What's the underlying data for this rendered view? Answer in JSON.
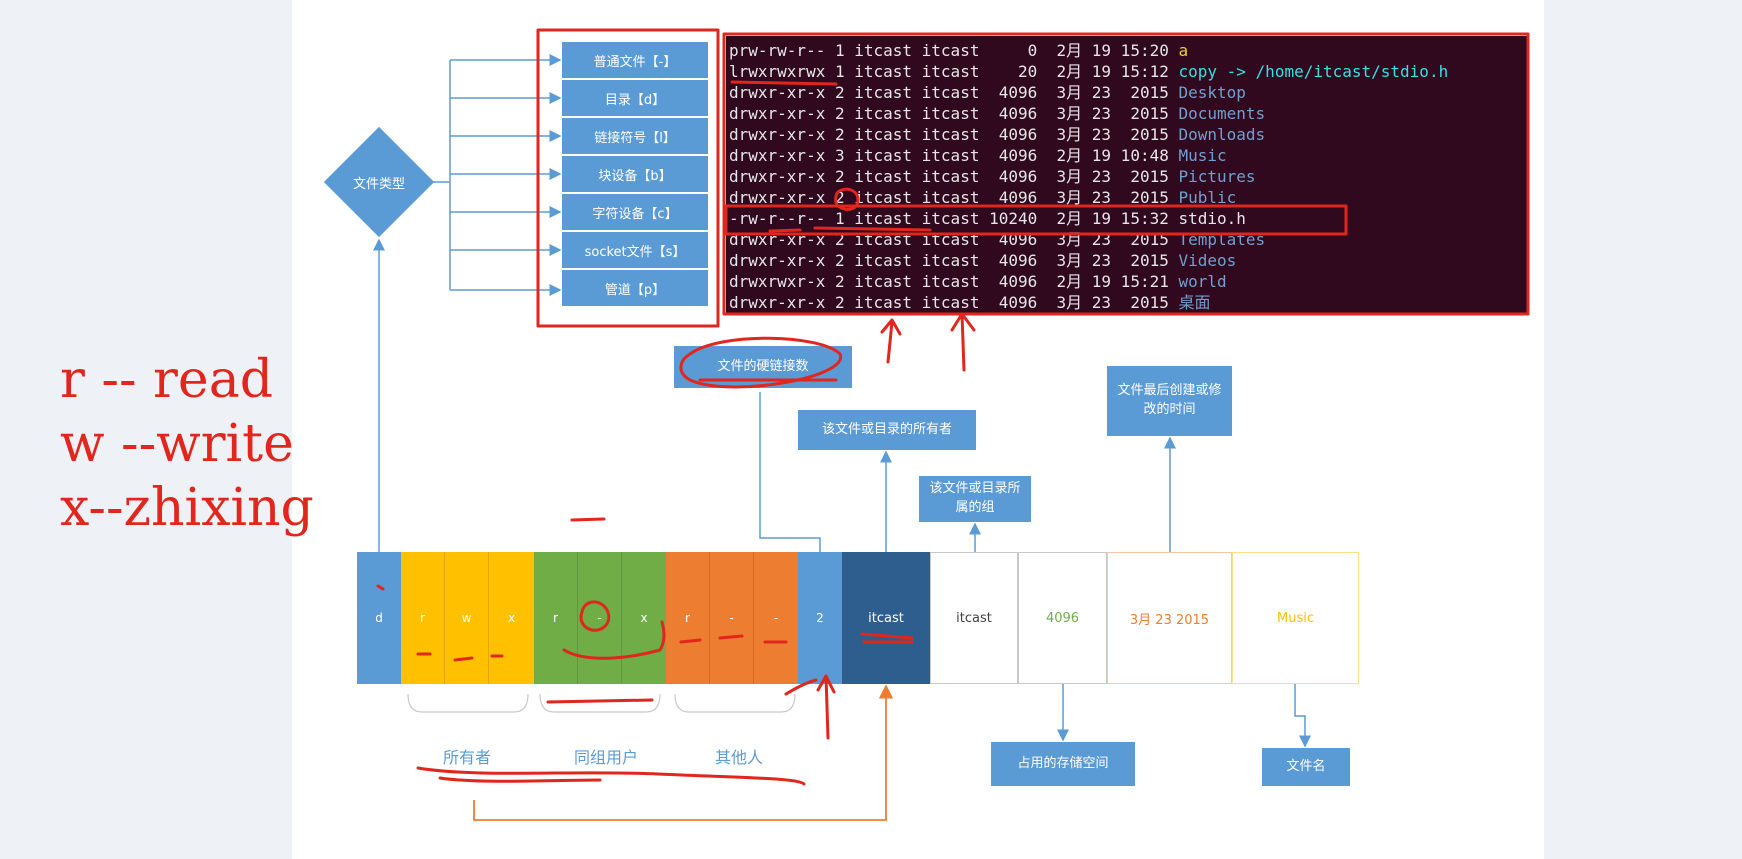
{
  "file_types": {
    "title": "文件类型",
    "items": [
      "普通文件【-】",
      "目录【d】",
      "链接符号【l】",
      "块设备【b】",
      "字符设备【c】",
      "socket文件【s】",
      "管道【p】"
    ]
  },
  "terminal": {
    "lines": [
      {
        "text": "prw-rw-r-- 1 itcast itcast     0  2月 19 15:20 ",
        "name": "a",
        "color": "yellow"
      },
      {
        "text": "lrwxrwxrwx 1 itcast itcast    20  2月 19 15:12 ",
        "name": "copy -> /home/itcast/stdio.h",
        "color": "cyan"
      },
      {
        "text": "drwxr-xr-x 2 itcast itcast  4096  3月 23  2015 ",
        "name": "Desktop",
        "color": "blue"
      },
      {
        "text": "drwxr-xr-x 2 itcast itcast  4096  3月 23  2015 ",
        "name": "Documents",
        "color": "blue"
      },
      {
        "text": "drwxr-xr-x 2 itcast itcast  4096  3月 23  2015 ",
        "name": "Downloads",
        "color": "blue"
      },
      {
        "text": "drwxr-xr-x 3 itcast itcast  4096  2月 19 10:48 ",
        "name": "Music",
        "color": "blue"
      },
      {
        "text": "drwxr-xr-x 2 itcast itcast  4096  3月 23  2015 ",
        "name": "Pictures",
        "color": "blue"
      },
      {
        "text": "drwxr-xr-x 2 itcast itcast  4096  3月 23  2015 ",
        "name": "Public",
        "color": "blue"
      },
      {
        "text": "-rw-r--r-- 1 itcast itcast 10240  2月 19 15:32 ",
        "name": "stdio.h",
        "color": "white"
      },
      {
        "text": "drwxr-xr-x 2 itcast itcast  4096  3月 23  2015 ",
        "name": "Templates",
        "color": "blue"
      },
      {
        "text": "drwxr-xr-x 2 itcast itcast  4096  3月 23  2015 ",
        "name": "Videos",
        "color": "blue"
      },
      {
        "text": "drwxrwxr-x 2 itcast itcast  4096  2月 19 15:21 ",
        "name": "world",
        "color": "blue"
      },
      {
        "text": "drwxr-xr-x 2 itcast itcast  4096  3月 23  2015 ",
        "name": "桌面",
        "color": "blue"
      }
    ]
  },
  "labels": {
    "hardlink": "文件的硬链接数",
    "owner": "该文件或目录的所有者",
    "group": "该文件或目录所属的组",
    "mtime": "文件最后创建或修改的时间",
    "size": "占用的存储空间",
    "filename": "文件名"
  },
  "permission_row": {
    "type": "d",
    "owner": [
      "r",
      "w",
      "x"
    ],
    "group": [
      "r",
      "-",
      "x"
    ],
    "other": [
      "r",
      "-",
      "-"
    ],
    "links": "2",
    "user": "itcast",
    "group_name": "itcast",
    "size": "4096",
    "date": "3月 23 2015",
    "name": "Music"
  },
  "groups": {
    "owner": "所有者",
    "group": "同组用户",
    "other": "其他人"
  },
  "handwriting": {
    "line1": "r -- read",
    "line2": "w --write",
    "line3": "x--zhixing"
  },
  "colors": {
    "blue": "#5b9bd5",
    "owner": "#ffc000",
    "group": "#70ad47",
    "other": "#ed7d31",
    "dark": "#2e5e8e",
    "annotation": "#e0261d"
  }
}
